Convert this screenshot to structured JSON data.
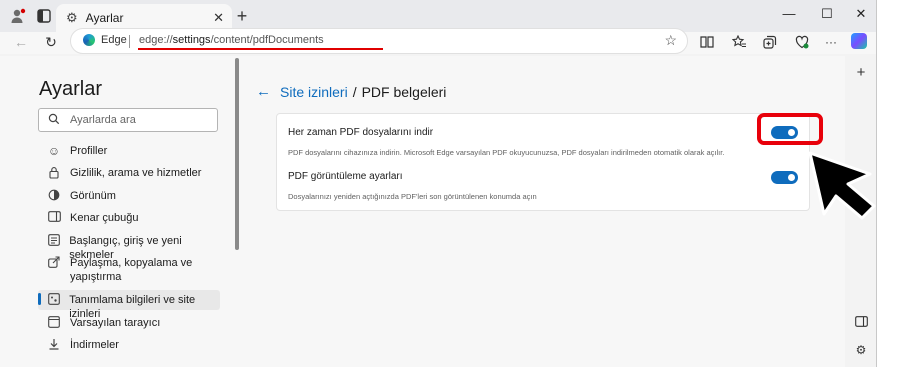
{
  "titlebar": {
    "tab_title": "Ayarlar",
    "tab_icon": "gear-icon",
    "new_tab_symbol": "+",
    "minimize_symbol": "—",
    "maximize_symbol": "☐",
    "close_symbol": "✕"
  },
  "toolbar": {
    "back_symbol": "←",
    "refresh_symbol": "↻",
    "edge_label": "Edge",
    "url_prefix": "edge://",
    "url_bold": "settings",
    "url_rest": "/content/pdfDocuments",
    "favorite_symbol": "☆"
  },
  "sidebar": {
    "title": "Ayarlar",
    "search_placeholder": "Ayarlarda ara",
    "items": [
      {
        "label": "Profiller",
        "icon": "profile-icon"
      },
      {
        "label": "Gizlilik, arama ve hizmetler",
        "icon": "lock-icon"
      },
      {
        "label": "Görünüm",
        "icon": "appearance-icon"
      },
      {
        "label": "Kenar çubuğu",
        "icon": "sidebar-icon"
      },
      {
        "label": "Başlangıç, giriş ve yeni sekmeler",
        "icon": "start-icon"
      },
      {
        "label": "Paylaşma, kopyalama ve yapıştırma",
        "icon": "share-icon"
      },
      {
        "label": "Tanımlama bilgileri ve site izinleri",
        "icon": "cookies-icon"
      },
      {
        "label": "Varsayılan tarayıcı",
        "icon": "browser-icon"
      },
      {
        "label": "İndirmeler",
        "icon": "download-icon"
      }
    ],
    "active_index": 6
  },
  "breadcrumb": {
    "back_symbol": "←",
    "parent": "Site izinleri",
    "separator": "/",
    "current": "PDF belgeleri"
  },
  "settings": [
    {
      "title": "Her zaman PDF dosyalarını indir",
      "description": "PDF dosyalarını cihazınıza indirin. Microsoft Edge varsayılan PDF okuyucunuzsa, PDF dosyaları indirilmeden otomatik olarak açılır.",
      "enabled": true
    },
    {
      "title": "PDF görüntüleme ayarları",
      "description": "Dosyalarınızı yeniden açtığınızda PDF'leri son görüntülenen konumda açın",
      "enabled": true
    }
  ],
  "colors": {
    "accent": "#0f6cbd",
    "highlight": "#e8000a"
  }
}
